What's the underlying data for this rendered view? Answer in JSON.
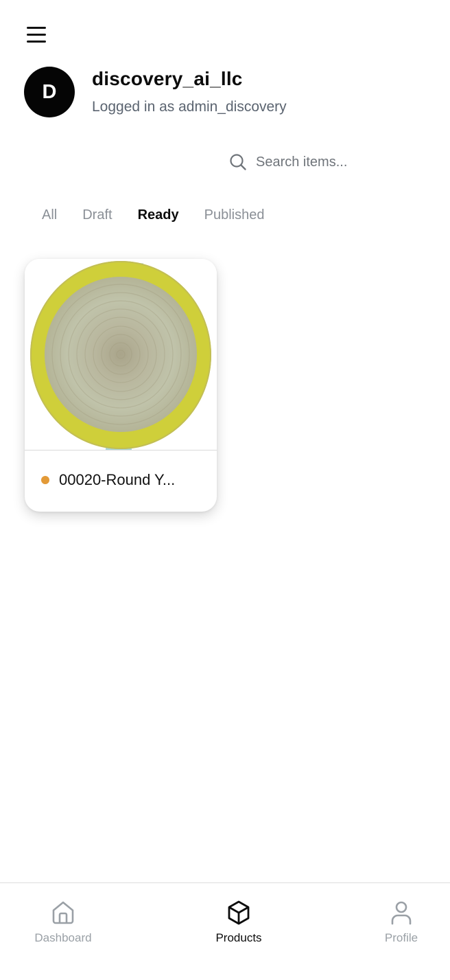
{
  "header": {
    "menu_icon": "hamburger-menu-icon",
    "avatar_letter": "D",
    "account_name": "discovery_ai_llc",
    "logged_in_text": "Logged in as admin_discovery"
  },
  "search": {
    "icon": "search-icon",
    "placeholder": "Search items..."
  },
  "tabs": [
    {
      "label": "All",
      "active": false
    },
    {
      "label": "Draft",
      "active": false
    },
    {
      "label": "Ready",
      "active": true
    },
    {
      "label": "Published",
      "active": false
    }
  ],
  "products": [
    {
      "title": "00020-Round Y...",
      "status_color": "#e39a37",
      "image": "round-yellow-jute-rug"
    }
  ],
  "bottom_nav": [
    {
      "label": "Dashboard",
      "icon": "home-icon",
      "active": false
    },
    {
      "label": "Products",
      "icon": "box-icon",
      "active": true
    },
    {
      "label": "Profile",
      "icon": "user-icon",
      "active": false
    }
  ],
  "colors": {
    "accent_dark": "#050505",
    "status_ready": "#e39a37",
    "inactive_text": "#9aa0a6"
  }
}
